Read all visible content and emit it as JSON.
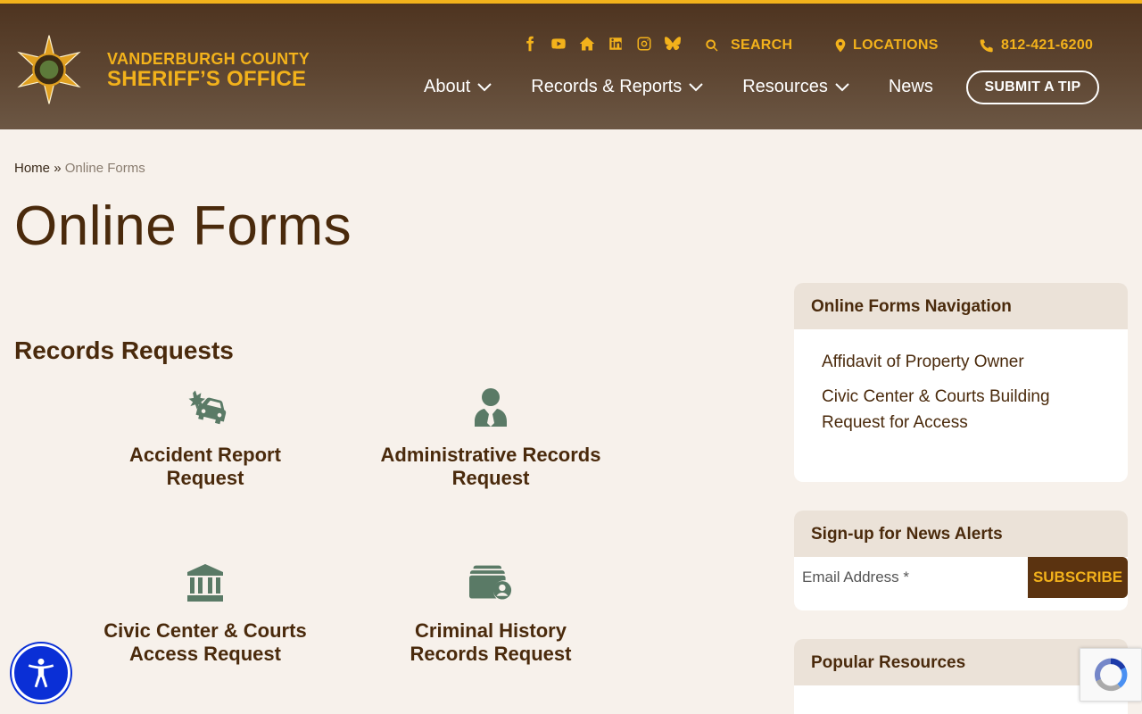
{
  "brand": {
    "line1": "VANDERBURGH COUNTY",
    "line2": "SHERIFF’S OFFICE",
    "accent": "#f3b21b",
    "header_bg": "#5e4632"
  },
  "social": [
    "facebook-icon",
    "youtube-icon",
    "home-icon",
    "linkedin-icon",
    "instagram-icon",
    "bluesky-icon"
  ],
  "utility": {
    "search": "SEARCH",
    "locations": "LOCATIONS",
    "phone": "812-421-6200"
  },
  "nav": {
    "about": "About",
    "records": "Records & Reports",
    "resources": "Resources",
    "news": "News",
    "tip": "SUBMIT A TIP"
  },
  "breadcrumb": {
    "home": "Home",
    "sep": "»",
    "current": "Online Forms"
  },
  "page_title": "Online Forms",
  "section_title": "Records Requests",
  "cards": [
    {
      "label": "Accident Report Request",
      "icon": "car-crash-icon"
    },
    {
      "label": "Administrative Records Request",
      "icon": "user-tie-icon"
    },
    {
      "label": "Civic Center & Courts Access Request",
      "icon": "courthouse-icon"
    },
    {
      "label": "Criminal History Records Request",
      "icon": "records-user-icon"
    }
  ],
  "sidebar": {
    "forms_nav": {
      "heading": "Online Forms Navigation",
      "links": [
        "Affidavit of Property Owner",
        "Civic Center & Courts Building Request for Access"
      ]
    },
    "alerts": {
      "heading": "Sign-up for News Alerts",
      "placeholder": "Email Address *",
      "button": "SUBSCRIBE"
    },
    "popular": {
      "heading": "Popular Resources"
    }
  }
}
